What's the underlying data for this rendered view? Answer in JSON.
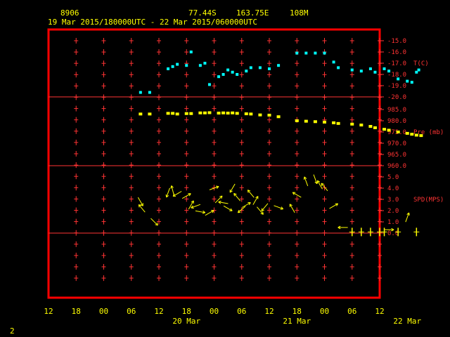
{
  "header": {
    "station_id": "8906",
    "lat": "77.44S",
    "lon": "163.75E",
    "elevation": "108M",
    "period": "19 Mar 2015/180000UTC - 22 Mar 2015/060000UTC"
  },
  "page_number": "2",
  "colors": {
    "background": "#000000",
    "frame": "#ff0000",
    "grid_red": "#ff3333",
    "text": "#ffff00",
    "temp": "#00ffff",
    "pressure": "#ffff00",
    "wind": "#ffff00"
  },
  "chart_data": [
    {
      "panel": "temperature",
      "type": "scatter",
      "ylabel": "T(C)",
      "y_ticks": [
        "-15.0",
        "-16.0",
        "-17.0",
        "-18.0",
        "-19.0",
        "-20.0"
      ],
      "ylim": [
        -20,
        -15
      ],
      "x_unit": "hours after 19 Mar 12 UTC",
      "points": [
        [
          20,
          -19.6
        ],
        [
          22,
          -19.6
        ],
        [
          26,
          -17.5
        ],
        [
          27,
          -17.3
        ],
        [
          28,
          -17.1
        ],
        [
          30,
          -17.2
        ],
        [
          31,
          -16.0
        ],
        [
          33,
          -17.2
        ],
        [
          34,
          -17.0
        ],
        [
          35,
          -18.9
        ],
        [
          37,
          -18.2
        ],
        [
          38,
          -18.0
        ],
        [
          39,
          -17.6
        ],
        [
          40,
          -17.8
        ],
        [
          41,
          -18.0
        ],
        [
          43,
          -17.7
        ],
        [
          44,
          -17.4
        ],
        [
          46,
          -17.4
        ],
        [
          48,
          -17.5
        ],
        [
          50,
          -17.2
        ],
        [
          54,
          -16.1
        ],
        [
          56,
          -16.1
        ],
        [
          58,
          -16.1
        ],
        [
          60,
          -16.1
        ],
        [
          62,
          -16.9
        ],
        [
          63,
          -17.4
        ],
        [
          66,
          -17.6
        ],
        [
          68,
          -17.7
        ],
        [
          70,
          -17.5
        ],
        [
          71,
          -17.8
        ],
        [
          73,
          -17.5
        ],
        [
          74,
          -17.7
        ],
        [
          76,
          -18.4
        ],
        [
          78,
          -18.6
        ],
        [
          79,
          -18.7
        ],
        [
          80,
          -17.8
        ],
        [
          80.5,
          -17.6
        ],
        [
          89,
          -14.9
        ],
        [
          89.3,
          -15.6
        ]
      ]
    },
    {
      "panel": "pressure",
      "type": "scatter",
      "ylabel": "Pre (mb)",
      "y_ticks": [
        "985.0",
        "980.0",
        "975.0",
        "970.0",
        "965.0",
        "960.0"
      ],
      "ylim": [
        960,
        985
      ],
      "x_unit": "hours after 19 Mar 12 UTC",
      "points": [
        [
          20,
          983.0
        ],
        [
          22,
          983.0
        ],
        [
          26,
          983.3
        ],
        [
          27,
          983.3
        ],
        [
          28,
          983.0
        ],
        [
          30,
          983.2
        ],
        [
          31,
          983.2
        ],
        [
          33,
          983.5
        ],
        [
          34,
          983.5
        ],
        [
          35,
          983.6
        ],
        [
          37,
          983.4
        ],
        [
          38,
          983.5
        ],
        [
          39,
          983.4
        ],
        [
          40,
          983.5
        ],
        [
          41,
          983.3
        ],
        [
          43,
          983.1
        ],
        [
          44,
          983.0
        ],
        [
          46,
          982.6
        ],
        [
          48,
          982.5
        ],
        [
          50,
          981.8
        ],
        [
          54,
          980.0
        ],
        [
          56,
          979.8
        ],
        [
          58,
          979.6
        ],
        [
          60,
          979.4
        ],
        [
          62,
          979.1
        ],
        [
          63,
          978.8
        ],
        [
          66,
          978.5
        ],
        [
          68,
          978.1
        ],
        [
          70,
          977.5
        ],
        [
          71,
          976.9
        ],
        [
          73,
          976.2
        ],
        [
          74,
          975.8
        ],
        [
          76,
          975.0
        ],
        [
          78,
          974.4
        ],
        [
          79,
          974.0
        ],
        [
          80,
          973.6
        ],
        [
          81,
          973.4
        ],
        [
          89,
          967.8
        ]
      ]
    },
    {
      "panel": "wind",
      "type": "scatter",
      "ylabel": "SPD(MPS)",
      "y_ticks": [
        "5.0",
        "4.0",
        "3.0",
        "2.0",
        "1.0",
        "0.0"
      ],
      "ylim": [
        0,
        5
      ],
      "x_unit": "hours after 19 Mar 12 UTC",
      "vectors": [
        [
          20,
          2.8,
          150
        ],
        [
          20.3,
          2.2,
          320
        ],
        [
          23,
          1.0,
          135
        ],
        [
          26,
          3.6,
          200
        ],
        [
          27,
          3.8,
          345
        ],
        [
          28,
          3.5,
          240
        ],
        [
          30,
          3.3,
          60
        ],
        [
          31,
          2.5,
          30
        ],
        [
          32,
          2.4,
          250
        ],
        [
          33,
          1.9,
          100
        ],
        [
          35,
          1.8,
          60
        ],
        [
          36,
          4.0,
          70
        ],
        [
          37,
          3.0,
          45
        ],
        [
          38,
          2.7,
          280
        ],
        [
          39,
          2.2,
          120
        ],
        [
          40,
          4.0,
          210
        ],
        [
          41,
          3.2,
          320
        ],
        [
          42,
          2.1,
          230
        ],
        [
          43,
          2.5,
          60
        ],
        [
          44,
          3.5,
          320
        ],
        [
          45,
          2.9,
          30
        ],
        [
          46,
          2.0,
          140
        ],
        [
          47,
          2.3,
          220
        ],
        [
          50,
          2.3,
          110
        ],
        [
          53,
          2.2,
          330
        ],
        [
          54,
          3.4,
          300
        ],
        [
          56,
          4.6,
          340
        ],
        [
          58,
          4.8,
          160
        ],
        [
          59,
          4.3,
          330
        ],
        [
          60,
          4.1,
          320
        ],
        [
          62,
          2.4,
          60
        ],
        [
          64,
          0.5,
          270
        ],
        [
          66,
          0.1,
          0
        ],
        [
          68,
          0.1,
          0
        ],
        [
          70,
          0.1,
          0
        ],
        [
          72,
          0.1,
          0
        ],
        [
          73,
          0.1,
          0
        ],
        [
          74,
          0.3,
          90
        ],
        [
          76,
          0.1,
          0
        ],
        [
          78,
          1.4,
          20
        ],
        [
          80,
          0.1,
          0
        ],
        [
          89,
          1.2,
          40
        ],
        [
          89.5,
          1.8,
          30
        ]
      ]
    }
  ],
  "x_axis": {
    "ticks": [
      "12",
      "18",
      "00",
      "06",
      "12",
      "18",
      "00",
      "06",
      "12",
      "18",
      "00",
      "06",
      "12"
    ],
    "dates": [
      "20 Mar",
      "21 Mar",
      "22 Mar"
    ]
  }
}
